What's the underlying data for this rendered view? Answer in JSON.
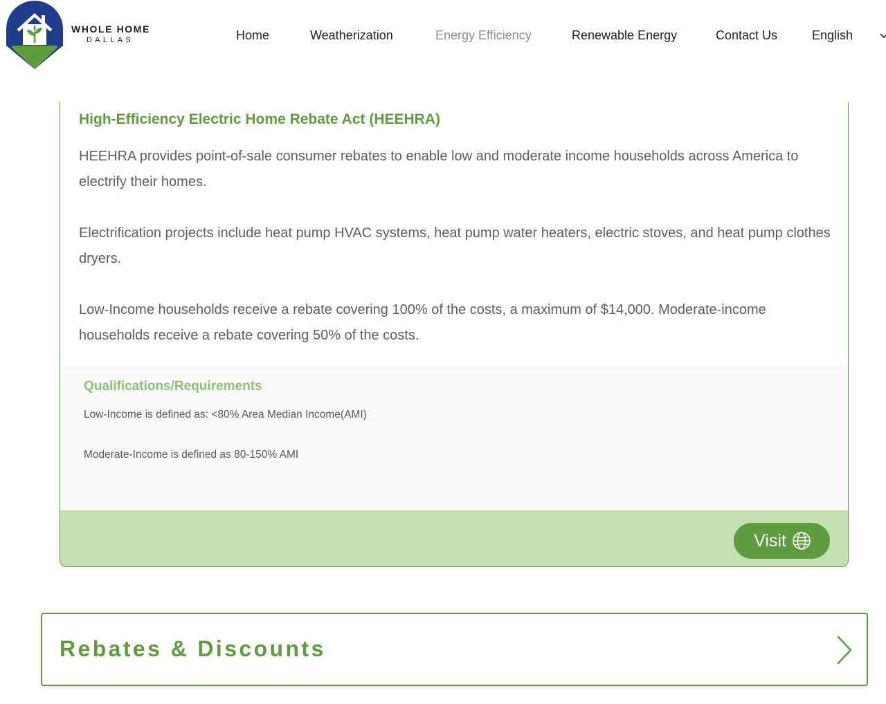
{
  "brand": {
    "name_line1": "WHOLE HOME",
    "name_line2": "DALLAS",
    "logo_icon": "house-with-sprout-logo",
    "colors": {
      "navy": "#1f3d8c",
      "green": "#5f9c3f"
    }
  },
  "nav": {
    "items": [
      {
        "label": "Home",
        "active": false
      },
      {
        "label": "Weatherization",
        "active": false
      },
      {
        "label": "Energy Efficiency",
        "active": true
      },
      {
        "label": "Renewable Energy",
        "active": false
      },
      {
        "label": "Contact Us",
        "active": false
      }
    ],
    "language": {
      "label": "English",
      "icon": "chevron-down-icon"
    }
  },
  "program": {
    "title": "High-Efficiency Electric Home Rebate Act (HEEHRA)",
    "paragraphs": [
      "HEEHRA provides point-of-sale consumer rebates to enable low and moderate income households across America to electrify their homes.",
      "Electrification projects include heat pump HVAC systems, heat pump water heaters, electric stoves, and heat pump clothes dryers.",
      "Low-Income households receive a rebate covering 100% of the costs, a maximum of $14,000. Moderate-income households receive a rebate covering 50% of the costs."
    ],
    "qualifications": {
      "title": "Qualifications/Requirements",
      "items": [
        "Low-Income is defined as: <80% Area Median Income(AMI)",
        "Moderate-Income is defined as 80-150% AMI"
      ]
    },
    "visit_button": {
      "label": "Visit",
      "icon": "globe-icon"
    }
  },
  "accordion": {
    "title": "Rebates & Discounts",
    "icon": "chevron-right-icon"
  },
  "colors": {
    "accent_green": "#5f9c3f",
    "light_green": "#8fc276",
    "footer_green": "#c5dfb2",
    "text_gray": "#5e5e5e",
    "panel_gray": "#f9f9f9"
  }
}
